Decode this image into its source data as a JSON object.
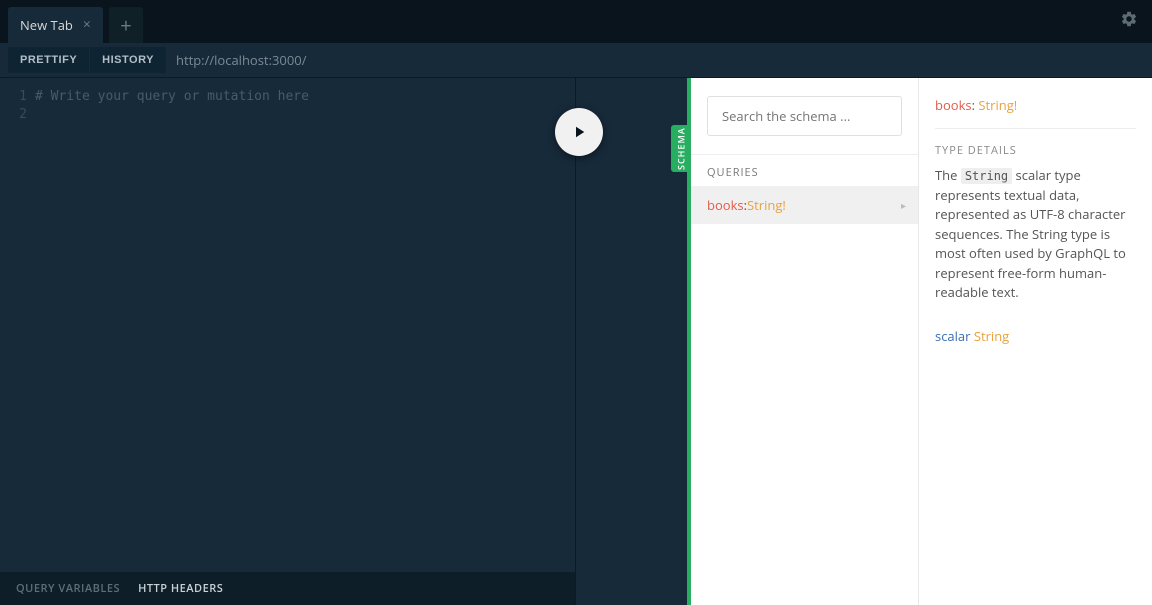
{
  "tabs": {
    "active": "New Tab",
    "close": "×",
    "add": "+"
  },
  "toolbar": {
    "prettify": "PRETTIFY",
    "history": "HISTORY",
    "url": "http://localhost:3000/"
  },
  "editor": {
    "lines": [
      "1",
      "2"
    ],
    "placeholder": "# Write your query or mutation here"
  },
  "bottom": {
    "query_variables": "QUERY VARIABLES",
    "http_headers": "HTTP HEADERS"
  },
  "schema": {
    "handle": "SCHEMA",
    "search_placeholder": "Search the schema ...",
    "queries_title": "QUERIES",
    "items": [
      {
        "name": "books",
        "colon": ": ",
        "type": "String!"
      }
    ],
    "arrow": "▸",
    "detail": {
      "name": "books",
      "colon": ": ",
      "type": "String!",
      "section_title": "TYPE DETAILS",
      "desc_pre": "The ",
      "desc_code": "String",
      "desc_post": " scalar type represents textual data, represented as UTF-8 character sequences. The String type is most often used by GraphQL to represent free-form human-readable text.",
      "scalar_kw": "scalar ",
      "scalar_type": "String"
    }
  }
}
